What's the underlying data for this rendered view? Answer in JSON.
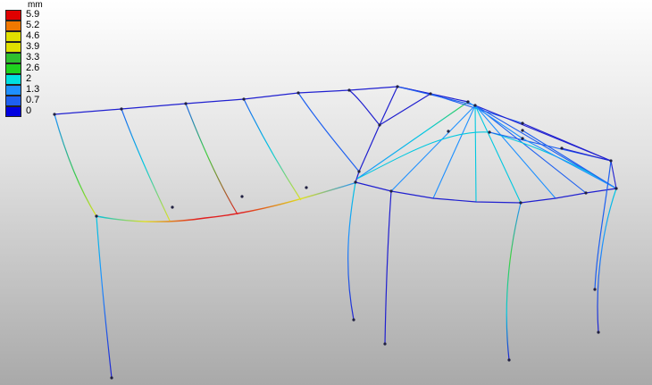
{
  "legend": {
    "unit": "mm",
    "entries": [
      {
        "label": "5.9",
        "color": "#e00000"
      },
      {
        "label": "5.2",
        "color": "#f07800"
      },
      {
        "label": "4.6",
        "color": "#e0e000"
      },
      {
        "label": "3.9",
        "color": "#e0e000"
      },
      {
        "label": "3.3",
        "color": "#2ec02e"
      },
      {
        "label": "2.6",
        "color": "#1ed21e"
      },
      {
        "label": "2",
        "color": "#00e0e0"
      },
      {
        "label": "1.3",
        "color": "#1e90ff"
      },
      {
        "label": "0.7",
        "color": "#1e60f0"
      },
      {
        "label": "0",
        "color": "#0000e0"
      }
    ]
  },
  "colors": {
    "frame_blue": "#2020d0",
    "deformed_cyan": "#00c8e0",
    "deformed_green": "#40d040",
    "deformed_yellow": "#e0e020",
    "deformed_red": "#e02020",
    "node": "#202040"
  }
}
